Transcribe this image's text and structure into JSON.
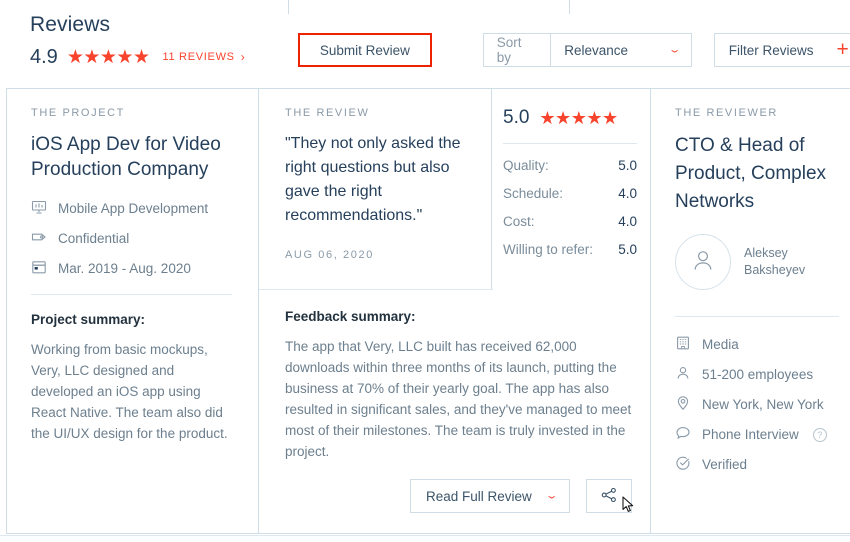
{
  "header": {
    "title": "Reviews",
    "score": "4.9",
    "stars": 5,
    "reviews_link": "11 REVIEWS",
    "chevron": "chevron-right-icon"
  },
  "toolbar": {
    "submit_label": "Submit Review",
    "sort_label": "Sort by",
    "sort_value": "Relevance",
    "filter_label": "Filter Reviews",
    "filter_plus": "+",
    "highlight_color": "#ee2200",
    "accent_color": "#f8432d"
  },
  "project": {
    "eyebrow": "THE PROJECT",
    "title": "iOS App Dev for Video Production Company",
    "meta": [
      {
        "icon": "presentation-screen-icon",
        "label": "Mobile App Development"
      },
      {
        "icon": "price-tag-icon",
        "label": "Confidential"
      },
      {
        "icon": "calendar-icon",
        "label": "Mar. 2019 - Aug. 2020"
      }
    ],
    "summary_heading": "Project summary:",
    "summary_body": "Working from basic mockups, Very, LLC designed and developed an iOS app using React Native. The team also did the UI/UX design for the product."
  },
  "review": {
    "eyebrow": "THE REVIEW",
    "quote": "\"They not only asked the right questions but also gave the right recommendations.\"",
    "date": "AUG 06, 2020",
    "overall_score": "5.0",
    "overall_stars": 5,
    "scores": [
      {
        "label": "Quality:",
        "value": "5.0"
      },
      {
        "label": "Schedule:",
        "value": "4.0"
      },
      {
        "label": "Cost:",
        "value": "4.0"
      },
      {
        "label": "Willing to refer:",
        "value": "5.0"
      }
    ],
    "feedback_heading": "Feedback summary:",
    "feedback_body": "The app that Very, LLC built has received 62,000 downloads within three months of its launch, putting the business at 70% of their yearly goal. The app has also resulted in significant sales, and they've managed to meet most of their milestones. The team is truly invested in the project.",
    "read_full_label": "Read Full Review",
    "share_icon": "share-nodes-icon"
  },
  "reviewer": {
    "eyebrow": "THE REVIEWER",
    "title": "CTO & Head of Product, Complex Networks",
    "avatar_icon": "user-avatar-icon",
    "name": "Aleksey Baksheyev",
    "facts": [
      {
        "icon": "building-icon",
        "label": "Media"
      },
      {
        "icon": "person-icon",
        "label": "51-200 employees"
      },
      {
        "icon": "location-pin-icon",
        "label": "New York, New York"
      },
      {
        "icon": "speech-bubble-icon",
        "label": "Phone Interview",
        "help": "?"
      },
      {
        "icon": "check-circle-icon",
        "label": "Verified"
      }
    ]
  }
}
